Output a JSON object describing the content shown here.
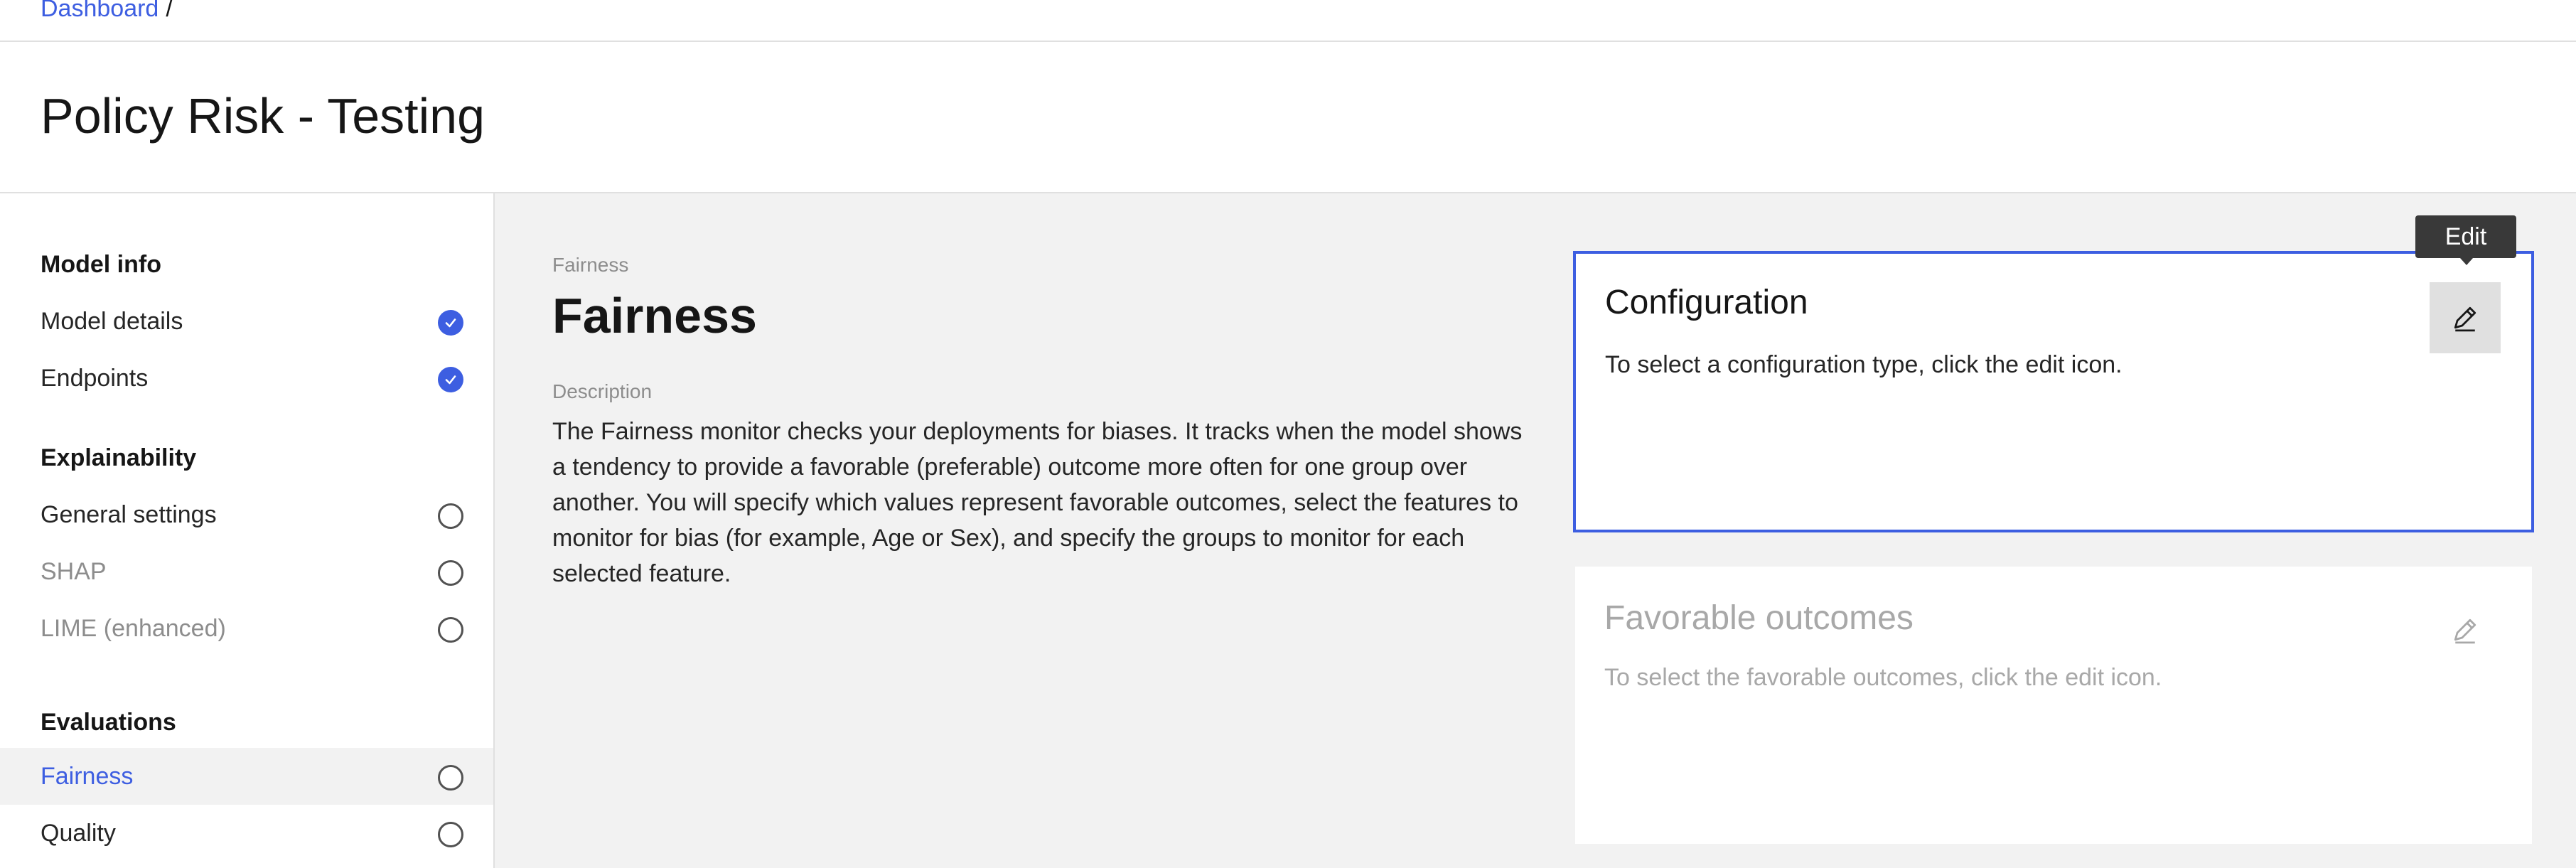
{
  "breadcrumb": {
    "link": "Dashboard",
    "separator": "/"
  },
  "page": {
    "title": "Policy Risk - Testing"
  },
  "sidebar": {
    "sections": [
      {
        "title": "Model info"
      },
      {
        "title": "Explainability"
      },
      {
        "title": "Evaluations"
      }
    ],
    "items": [
      {
        "label": "Model details",
        "status": "complete"
      },
      {
        "label": "Endpoints",
        "status": "complete"
      },
      {
        "label": "General settings",
        "status": "incomplete"
      },
      {
        "label": "SHAP",
        "status": "incomplete"
      },
      {
        "label": "LIME (enhanced)",
        "status": "incomplete"
      },
      {
        "label": "Fairness",
        "status": "incomplete"
      },
      {
        "label": "Quality",
        "status": "incomplete"
      }
    ]
  },
  "main": {
    "eyebrow": "Fairness",
    "title": "Fairness",
    "description_label": "Description",
    "description": "The Fairness monitor checks your deployments for biases. It tracks when the model shows a tendency to provide a favorable (preferable) outcome more often for one group over another. You will specify which values represent favorable outcomes, select the features to monitor for bias (for example, Age or Sex), and specify the groups to monitor for each selected feature."
  },
  "cards": {
    "configuration": {
      "title": "Configuration",
      "text": "To select a configuration type, click the edit icon."
    },
    "favorable": {
      "title": "Favorable outcomes",
      "text": "To select the favorable outcomes, click the edit icon."
    }
  },
  "tooltip": {
    "text": "Edit"
  },
  "icons": {
    "edit": "pencil-edit-icon",
    "complete": "checkmark-icon",
    "incomplete": "empty-circle-icon"
  },
  "colors": {
    "accent": "#3d5ee1",
    "background": "#f2f2f2",
    "tooltip": "#393939"
  }
}
